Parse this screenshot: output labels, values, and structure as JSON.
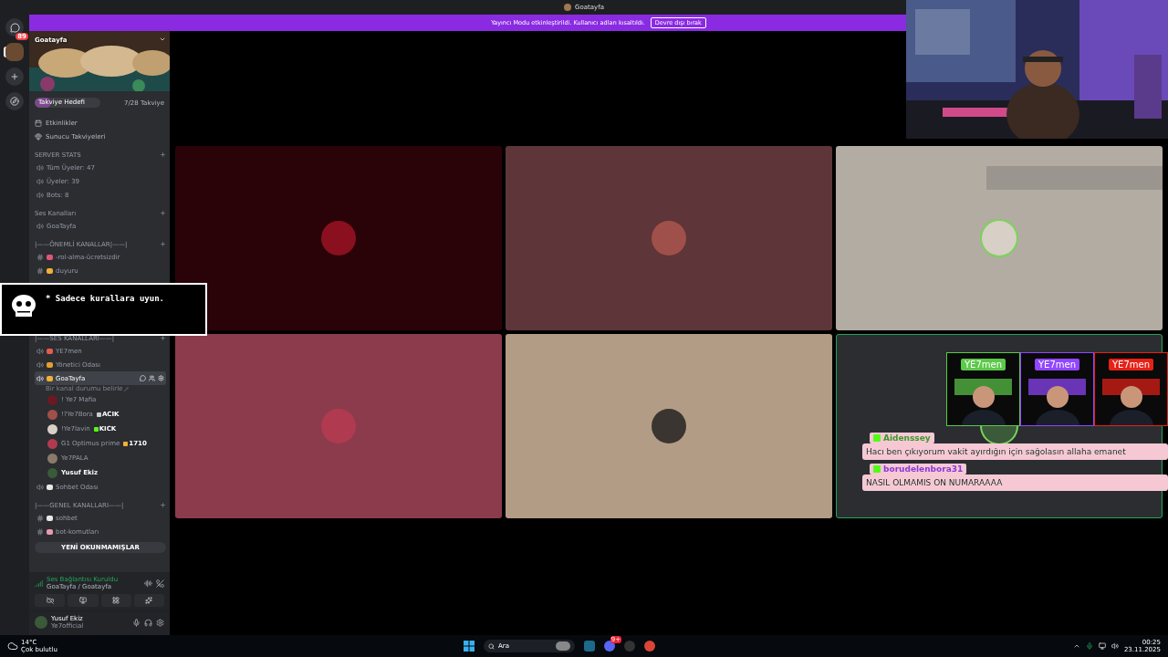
{
  "window": {
    "title": "Goatayfa"
  },
  "banner": {
    "message": "Yayıncı Modu etkinleştirildi. Kullanıcı adları kısaltıldı.",
    "button": "Devre dışı bırak"
  },
  "server_rail": [
    {
      "kind": "home",
      "badge": "89",
      "selected": false
    },
    {
      "kind": "server",
      "selected": true
    },
    {
      "kind": "add",
      "selected": false
    },
    {
      "kind": "discover",
      "selected": false
    }
  ],
  "server": {
    "name": "Goatayfa",
    "boost_label": "Takviye Hedefi",
    "boost_count": "7/28 Takviye",
    "level": 0.25
  },
  "nav": [
    {
      "kind": "events",
      "label": "Etkinlikler"
    },
    {
      "kind": "boosts",
      "label": "Sunucu Takviyeleri"
    }
  ],
  "categories": [
    {
      "name": "SERVER STATS",
      "channels": [
        {
          "kind": "voice",
          "name": "Tüm Üyeler: 47",
          "selected": false
        },
        {
          "kind": "voice",
          "name": "Üyeler: 39",
          "selected": false
        },
        {
          "kind": "voice",
          "name": "Bots: 8",
          "selected": false
        }
      ]
    },
    {
      "name": "Ses Kanalları",
      "channels": [
        {
          "kind": "voice",
          "name": "GoaTayfa",
          "selected": false
        }
      ]
    },
    {
      "name": "|——ÖNEMLİ KANALLAR|——|",
      "channels": [
        {
          "kind": "text",
          "name": "-rol-alma-ücretsizdir",
          "color": "#e0557a",
          "selected": false
        },
        {
          "kind": "text",
          "name": "duyuru",
          "color": "#f0b232",
          "selected": false
        }
      ]
    },
    {
      "name": "|——SES KANALLARI——|",
      "channels": [
        {
          "kind": "voice",
          "name": "YE7men",
          "color": "#e85a4f",
          "selected": false
        },
        {
          "kind": "voice",
          "name": "Yönetici Odası",
          "color": "#e0a030",
          "selected": false
        },
        {
          "kind": "voice",
          "name": "GoaTayfa",
          "color": "#f0b232",
          "selected": true,
          "status": "Bir kanal durumu belirle",
          "members": [
            {
              "name": "! Ye7 Mafia",
              "color": "#6a1a22",
              "self": false
            },
            {
              "name": "!?Ye7Bora",
              "color": "#a0504a",
              "self": false,
              "tag": {
                "text": "ACIK",
                "color": "#c9ccd1"
              }
            },
            {
              "name": "!Ye7lavin",
              "color": "#d8cfc6",
              "self": false,
              "tag": {
                "text": "KICK",
                "color": "#53fc18"
              }
            },
            {
              "name": "G1 Optimus prime",
              "color": "#b03a50",
              "self": false,
              "tag": {
                "text": "1710",
                "color": "#f0b232"
              }
            },
            {
              "name": "Ye7PALA",
              "color": "#8a7a6a",
              "self": false
            },
            {
              "name": "Yusuf Ekiz",
              "color": "#3a5a3a",
              "self": true
            }
          ]
        },
        {
          "kind": "voice",
          "name": "Sohbet Odası",
          "color": "#e8e8e8",
          "selected": false
        }
      ]
    },
    {
      "name": "|——GENEL KANALLARI——|",
      "channels": [
        {
          "kind": "text",
          "name": "sohbet",
          "color": "#e8e8e8",
          "selected": false
        },
        {
          "kind": "text",
          "name": "bot-komutları",
          "color": "#e89ab0",
          "selected": false
        }
      ]
    }
  ],
  "unread_pill": "YENİ OKUNMAMIŞLAR",
  "voice_panel": {
    "status": "Ses Bağlantısı Kuruldu",
    "location": "GoaTayfa / Goatayfa"
  },
  "user_panel": {
    "name": "Yusuf Ekiz",
    "status": "Ye7official"
  },
  "tiles": [
    {
      "color": "#2a0309",
      "avatar": {
        "color": "#8a1020"
      },
      "speaking": false,
      "highlighted": false
    },
    {
      "color": "#5e3538",
      "avatar": {
        "color": "#a0504a"
      },
      "speaking": false,
      "highlighted": false
    },
    {
      "color": "#b3aca3",
      "avatar": {
        "color": "#d8cfc6"
      },
      "speaking": true,
      "highlighted": false,
      "blurred_bar": true
    },
    {
      "color": "#8c3b4c",
      "avatar": {
        "color": "#b03a50"
      },
      "speaking": false,
      "highlighted": false
    },
    {
      "color": "#b39c85",
      "avatar": {
        "color": "#3a3530"
      },
      "speaking": false,
      "highlighted": false
    },
    {
      "color": "#2b2d31",
      "avatar": {
        "color": "#3a5a3a"
      },
      "speaking": true,
      "highlighted": true
    }
  ],
  "dialog": {
    "text": "* Sadece kurallara uyun."
  },
  "social_cards": [
    {
      "label": "YE7men",
      "color": "#5cc94a"
    },
    {
      "label": "YE7men",
      "color": "#9146ff"
    },
    {
      "label": "YE7men",
      "color": "#e62117"
    }
  ],
  "chat": [
    {
      "user": "Aidenssey",
      "color": "#3a9a2a",
      "text": "Hacı ben çıkıyorum vakit ayırdığın için sağolasın allaha emanet"
    },
    {
      "user": "borudelenbora31",
      "color": "#8a3ad8",
      "text": "NASIL OLMAMIS ON NUMARAAAA"
    }
  ],
  "taskbar": {
    "weather_temp": "14°C",
    "weather_text": "Çok bulutlu",
    "search": "Ara",
    "discord_badge": "9+",
    "time": "00:25",
    "date": "23.11.2025"
  }
}
